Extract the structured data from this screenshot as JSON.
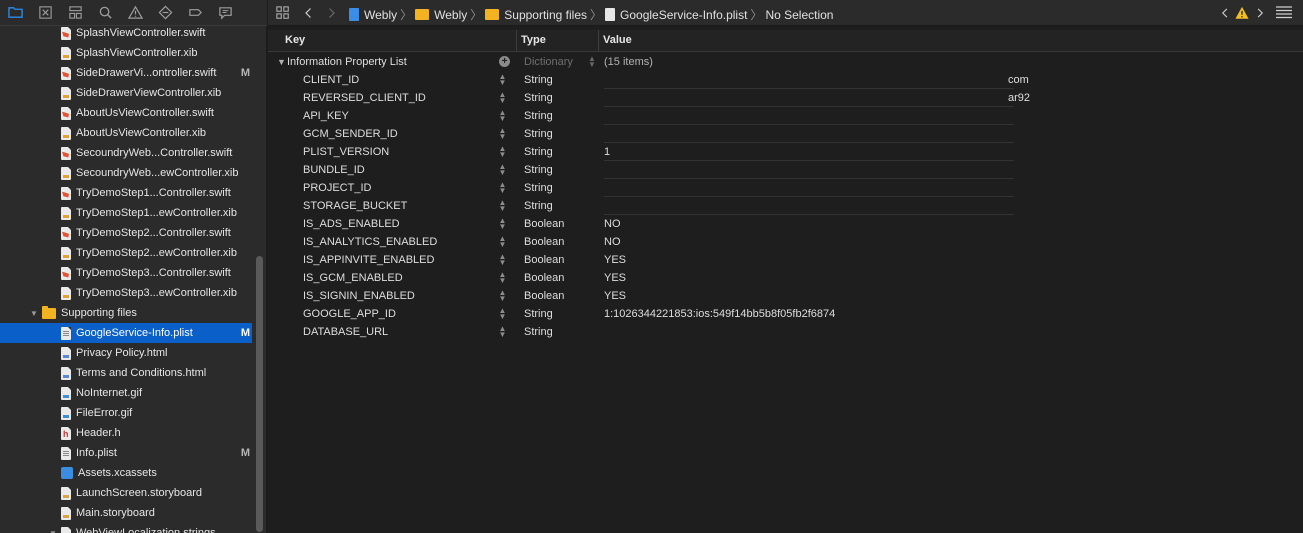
{
  "navigator": {
    "toolbar_icons": [
      "folder-icon",
      "source-control-icon",
      "hierarchy-icon",
      "search-icon",
      "warning-icon",
      "test-diamond-icon",
      "breakpoint-icon",
      "report-icon"
    ],
    "files": [
      {
        "name": "SplashViewController.swift",
        "type": "swift",
        "status": ""
      },
      {
        "name": "SplashViewController.xib",
        "type": "xib",
        "status": ""
      },
      {
        "name": "SideDrawerVi...ontroller.swift",
        "type": "swift",
        "status": "M"
      },
      {
        "name": "SideDrawerViewController.xib",
        "type": "xib",
        "status": ""
      },
      {
        "name": "AboutUsViewController.swift",
        "type": "swift",
        "status": ""
      },
      {
        "name": "AboutUsViewController.xib",
        "type": "xib",
        "status": ""
      },
      {
        "name": "SecoundryWeb...Controller.swift",
        "type": "swift",
        "status": ""
      },
      {
        "name": "SecoundryWeb...ewController.xib",
        "type": "xib",
        "status": ""
      },
      {
        "name": "TryDemoStep1...Controller.swift",
        "type": "swift",
        "status": ""
      },
      {
        "name": "TryDemoStep1...ewController.xib",
        "type": "xib",
        "status": ""
      },
      {
        "name": "TryDemoStep2...Controller.swift",
        "type": "swift",
        "status": ""
      },
      {
        "name": "TryDemoStep2...ewController.xib",
        "type": "xib",
        "status": ""
      },
      {
        "name": "TryDemoStep3...Controller.swift",
        "type": "swift",
        "status": ""
      },
      {
        "name": "TryDemoStep3...ewController.xib",
        "type": "xib",
        "status": ""
      },
      {
        "name": "Supporting files",
        "type": "folder",
        "status": ""
      },
      {
        "name": "GoogleService-Info.plist",
        "type": "plist",
        "status": "M",
        "selected": true
      },
      {
        "name": "Privacy Policy.html",
        "type": "html",
        "status": ""
      },
      {
        "name": "Terms and Conditions.html",
        "type": "html",
        "status": ""
      },
      {
        "name": "NoInternet.gif",
        "type": "gif",
        "status": ""
      },
      {
        "name": "FileError.gif",
        "type": "gif",
        "status": ""
      },
      {
        "name": "Header.h",
        "type": "h",
        "status": ""
      },
      {
        "name": "Info.plist",
        "type": "plist",
        "status": "M"
      },
      {
        "name": "Assets.xcassets",
        "type": "assets",
        "status": ""
      },
      {
        "name": "LaunchScreen.storyboard",
        "type": "sb",
        "status": ""
      },
      {
        "name": "Main.storyboard",
        "type": "sb",
        "status": ""
      },
      {
        "name": "WebViewLocalization.strings",
        "type": "strings",
        "status": ""
      }
    ]
  },
  "jumpbar": {
    "crumbs": [
      "Webly",
      "Webly",
      "Supporting files",
      "GoogleService-Info.plist",
      "No Selection"
    ]
  },
  "editor": {
    "headers": {
      "key": "Key",
      "type": "Type",
      "value": "Value"
    },
    "root": {
      "key": "Information Property List",
      "type": "Dictionary",
      "value": "(15 items)"
    },
    "rows": [
      {
        "key": "CLIENT_ID",
        "type": "String",
        "value": "",
        "tail": "com"
      },
      {
        "key": "REVERSED_CLIENT_ID",
        "type": "String",
        "value": "",
        "tail": "ar92"
      },
      {
        "key": "API_KEY",
        "type": "String",
        "value": "",
        "tail": ""
      },
      {
        "key": "GCM_SENDER_ID",
        "type": "String",
        "value": "",
        "tail": ""
      },
      {
        "key": "PLIST_VERSION",
        "type": "String",
        "value": "1",
        "tail": ""
      },
      {
        "key": "BUNDLE_ID",
        "type": "String",
        "value": "",
        "tail": ""
      },
      {
        "key": "PROJECT_ID",
        "type": "String",
        "value": "",
        "tail": ""
      },
      {
        "key": "STORAGE_BUCKET",
        "type": "String",
        "value": "",
        "tail": ""
      },
      {
        "key": "IS_ADS_ENABLED",
        "type": "Boolean",
        "value": "NO",
        "tail": ""
      },
      {
        "key": "IS_ANALYTICS_ENABLED",
        "type": "Boolean",
        "value": "NO",
        "tail": ""
      },
      {
        "key": "IS_APPINVITE_ENABLED",
        "type": "Boolean",
        "value": "YES",
        "tail": ""
      },
      {
        "key": "IS_GCM_ENABLED",
        "type": "Boolean",
        "value": "YES",
        "tail": ""
      },
      {
        "key": "IS_SIGNIN_ENABLED",
        "type": "Boolean",
        "value": "YES",
        "tail": ""
      },
      {
        "key": "GOOGLE_APP_ID",
        "type": "String",
        "value": "1:1026344221853:ios:549f14bb5b8f05fb2f6874",
        "tail": ""
      },
      {
        "key": "DATABASE_URL",
        "type": "String",
        "value": "",
        "tail": ""
      }
    ]
  }
}
